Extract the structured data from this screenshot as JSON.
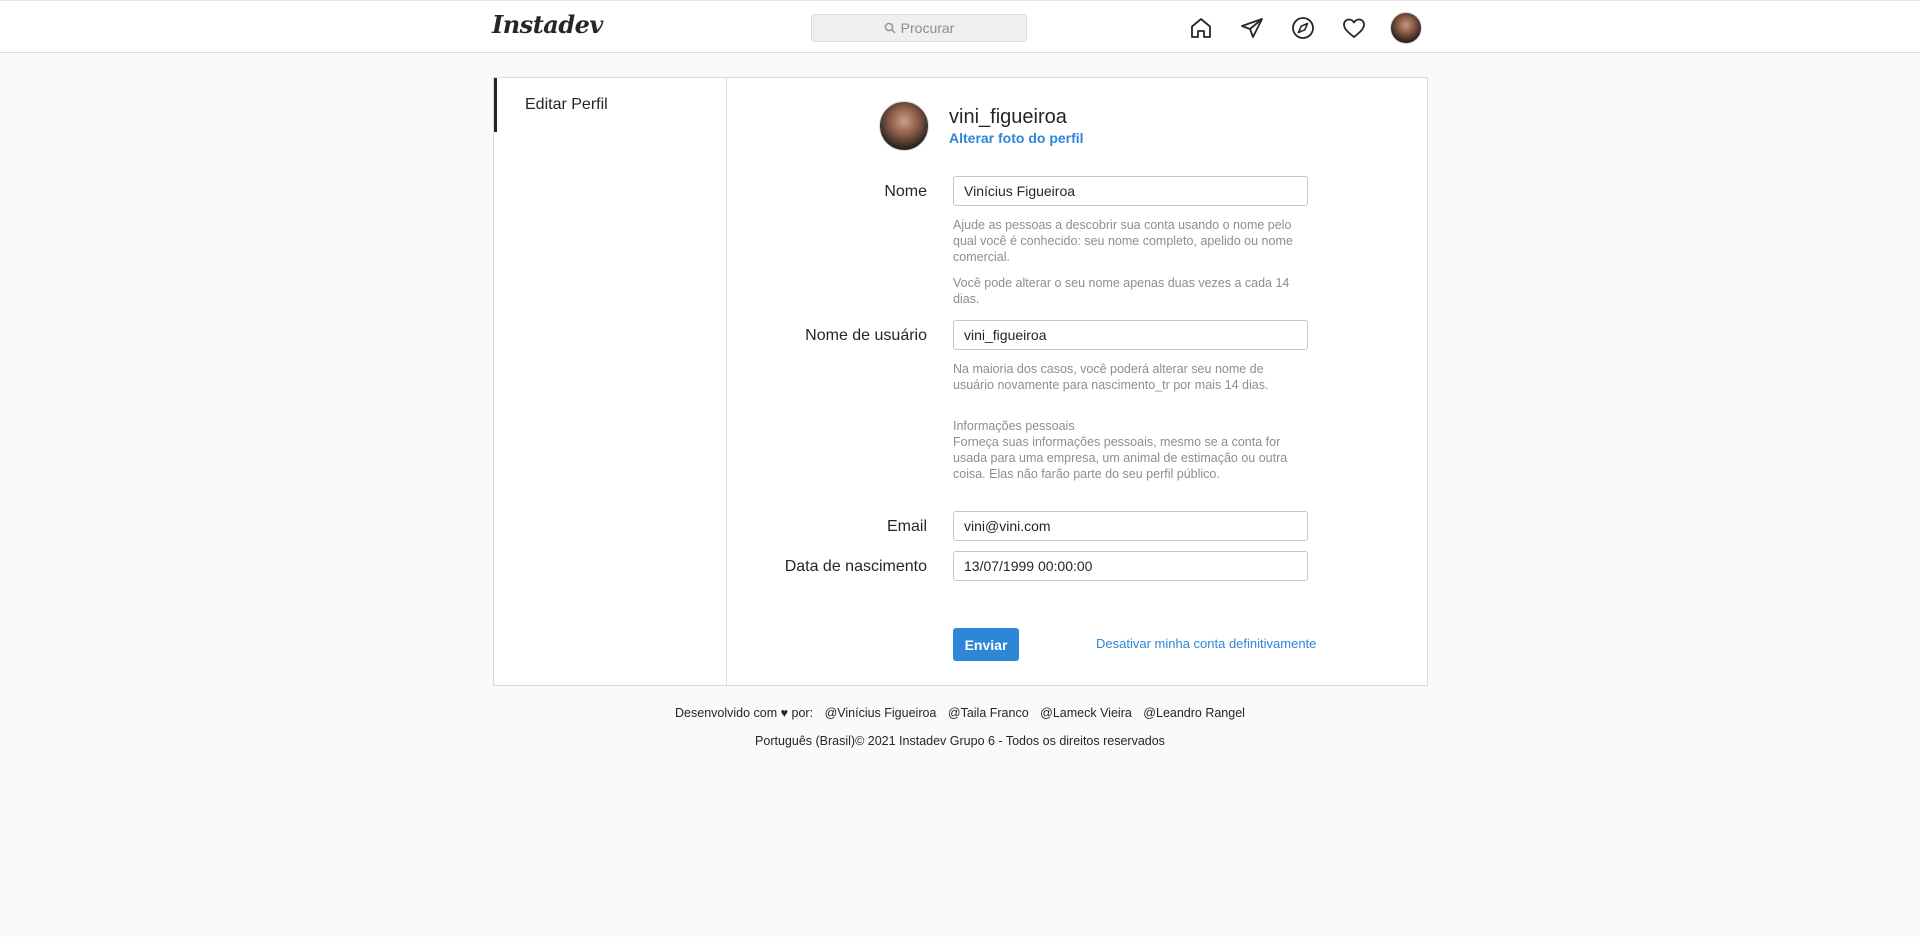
{
  "brand": {
    "logo_text": "Instadev"
  },
  "search": {
    "placeholder": "Procurar"
  },
  "nav": {
    "icons": [
      "home-icon",
      "direct-icon",
      "explore-icon",
      "activity-icon"
    ]
  },
  "sidebar": {
    "items": [
      {
        "label": "Editar Perfil"
      }
    ]
  },
  "profile": {
    "username": "vini_figueiroa",
    "change_photo": "Alterar foto do perfil"
  },
  "form": {
    "name": {
      "label": "Nome",
      "value": "Vinícius Figueiroa",
      "help1": "Ajude as pessoas a descobrir sua conta usando o nome pelo qual você é conhecido: seu nome completo, apelido ou nome comercial.",
      "help2": "Você pode alterar o seu nome apenas duas vezes a cada 14 dias."
    },
    "username": {
      "label": "Nome de usuário",
      "value": "vini_figueiroa",
      "help": "Na maioria dos casos, você poderá alterar seu nome de usuário novamente para nascimento_tr por mais 14 dias."
    },
    "personal": {
      "title": "Informações pessoais",
      "text": "Forneça suas informações pessoais, mesmo se a conta for usada para uma empresa, um animal de estimação ou outra coisa. Elas não farão parte do seu perfil público."
    },
    "email": {
      "label": "Email",
      "value": "vini@vini.com"
    },
    "birth": {
      "label": "Data de nascimento",
      "value": "13/07/1999 00:00:00"
    },
    "submit_label": "Enviar",
    "disable_label": "Desativar minha conta definitivamente"
  },
  "footer": {
    "prefix": "Desenvolvido com ♥ por:",
    "credits": [
      "@Vinícius Figueiroa",
      "@Taila Franco",
      "@Lameck Vieira",
      "@Leandro Rangel"
    ],
    "copyright": "Português (Brasil)© 2021 Instadev Grupo 6 - Todos os direitos reservados"
  },
  "colors": {
    "accent": "#2e86d6",
    "border": "#dbdbdb",
    "background": "#fafafa",
    "muted_text": "#8e8e8e"
  }
}
